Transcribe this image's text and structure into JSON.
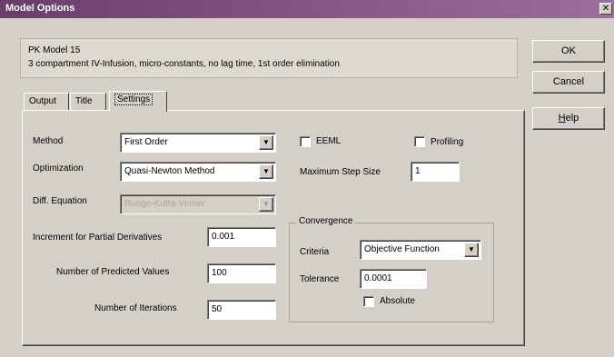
{
  "window": {
    "title": "Model Options",
    "close_glyph": "✕"
  },
  "description": {
    "line1": "PK Model 15",
    "line2": "3 compartment IV-Infusion, micro-constants, no lag time, 1st order elimination"
  },
  "buttons": {
    "ok": "OK",
    "cancel": "Cancel",
    "help": "Help"
  },
  "tabs": [
    {
      "label": "Output",
      "active": false
    },
    {
      "label": "Title",
      "active": false
    },
    {
      "label": "Settings",
      "active": true
    }
  ],
  "settings": {
    "method": {
      "label": "Method",
      "value": "First Order"
    },
    "optimization": {
      "label": "Optimization",
      "value": "Quasi-Newton Method"
    },
    "diff_equation": {
      "label": "Diff. Equation",
      "value": "Runge-Kutta-Verner"
    },
    "increment": {
      "label": "Increment for Partial Derivatives",
      "value": "0.001"
    },
    "num_predicted": {
      "label": "Number of Predicted Values",
      "value": "100"
    },
    "num_iterations": {
      "label": "Number of Iterations",
      "value": "50"
    },
    "eeml": {
      "label": "EEML",
      "checked": false
    },
    "profiling": {
      "label": "Profiling",
      "checked": false
    },
    "max_step": {
      "label": "Maximum Step Size",
      "value": "1"
    },
    "convergence": {
      "title": "Convergence",
      "criteria": {
        "label": "Criteria",
        "value": "Objective Function"
      },
      "tolerance": {
        "label": "Tolerance",
        "value": "0.0001"
      },
      "absolute": {
        "label": "Absolute",
        "checked": false
      }
    }
  },
  "icons": {
    "dropdown": "▼"
  }
}
